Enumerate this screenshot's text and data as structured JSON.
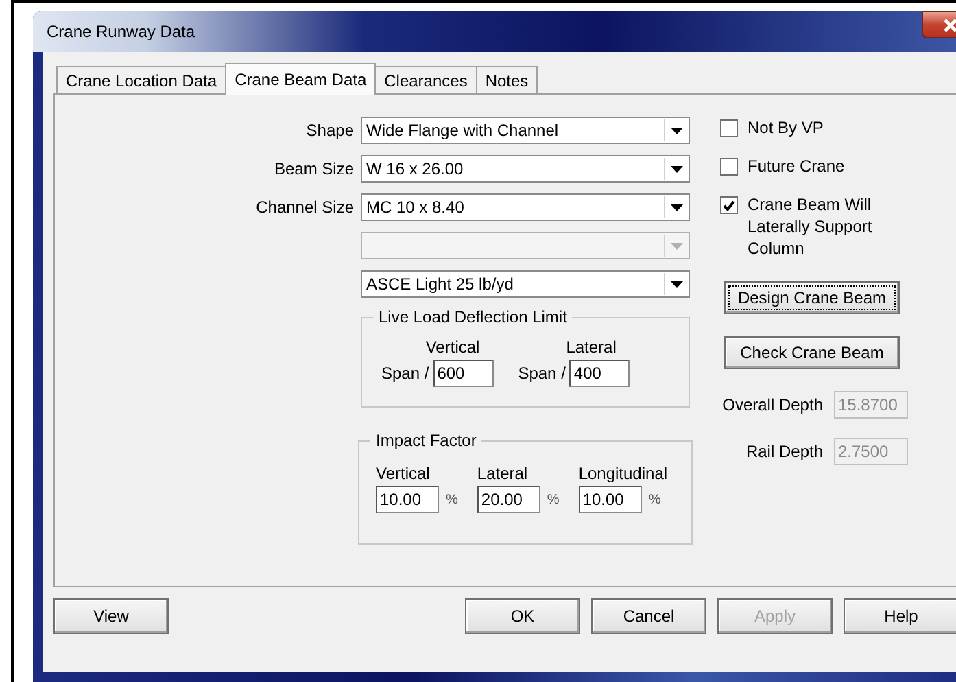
{
  "window": {
    "title": "Crane Runway Data"
  },
  "tabs": [
    {
      "label": "Crane Location Data",
      "selected": false
    },
    {
      "label": "Crane Beam Data",
      "selected": true
    },
    {
      "label": "Clearances",
      "selected": false
    },
    {
      "label": "Notes",
      "selected": false
    }
  ],
  "dropdowns": [
    {
      "label": "Shape",
      "value": "Wide Flange with Channel",
      "disabled": false
    },
    {
      "label": "Beam Size",
      "value": "W 16 x 26.00",
      "disabled": false
    },
    {
      "label": "Channel Size",
      "value": "MC 10 x 8.40",
      "disabled": false
    },
    {
      "disabled": true
    },
    {
      "value": "ASCE Light 25 lb/yd",
      "disabled": false
    }
  ],
  "deflection_group": {
    "title": "Live Load Deflection Limit",
    "fields": [
      {
        "heading": "Vertical",
        "prefix": "Span /",
        "value": "600"
      },
      {
        "heading": "Lateral",
        "prefix": "Span /",
        "value": "400"
      }
    ]
  },
  "impact_group": {
    "title": "Impact Factor",
    "fields": [
      {
        "heading": "Vertical",
        "value": "10.00",
        "unit": "%"
      },
      {
        "heading": "Lateral",
        "value": "20.00",
        "unit": "%"
      },
      {
        "heading": "Longitudinal",
        "value": "10.00",
        "unit": "%"
      }
    ]
  },
  "checkboxes": [
    {
      "label": "Not By VP",
      "checked": false
    },
    {
      "label": "Future Crane",
      "checked": false
    },
    {
      "label": "Crane Beam Will Laterally Support Column",
      "checked": true
    }
  ],
  "action_buttons": [
    {
      "label": "Design Crane Beam",
      "focused": true
    },
    {
      "label": "Check Crane Beam",
      "focused": false
    }
  ],
  "readouts": [
    {
      "label": "Overall Depth",
      "value": "15.8700",
      "disabled": true
    },
    {
      "label": "Rail Depth",
      "value": "2.7500",
      "disabled": true
    }
  ],
  "footer_buttons": [
    {
      "label": "View",
      "disabled": false,
      "kind": "left"
    },
    {
      "label": "OK",
      "disabled": false,
      "kind": "right"
    },
    {
      "label": "Cancel",
      "disabled": false,
      "kind": "right"
    },
    {
      "label": "Apply",
      "disabled": true,
      "kind": "right"
    },
    {
      "label": "Help",
      "disabled": false,
      "kind": "right"
    }
  ]
}
